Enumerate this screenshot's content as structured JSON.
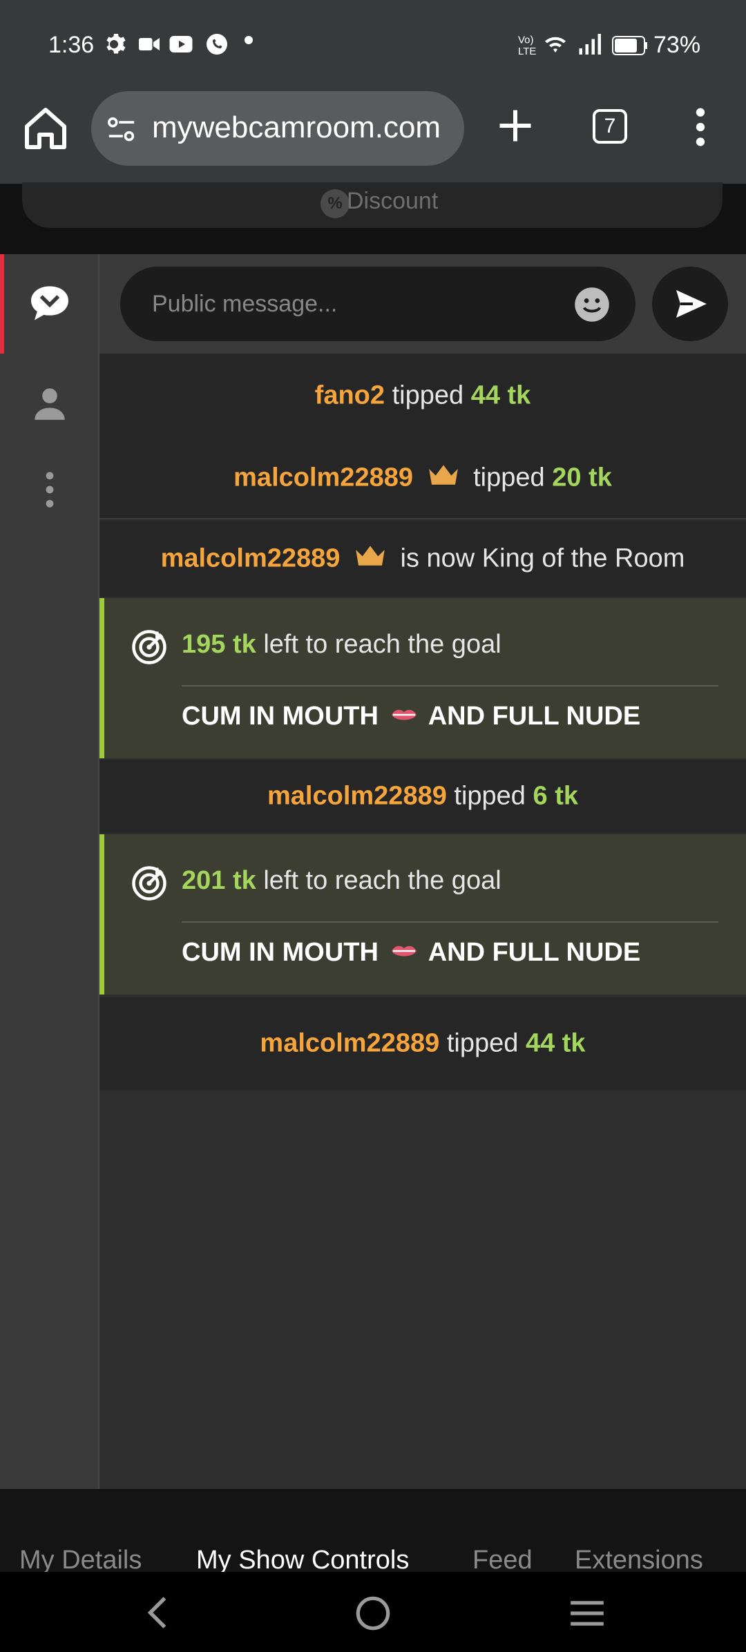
{
  "status_bar": {
    "time": "1:36",
    "battery": "73%"
  },
  "browser": {
    "url": "mywebcamroom.com",
    "tab_count": "7"
  },
  "discount": {
    "label": "Discount"
  },
  "composer": {
    "placeholder": "Public message..."
  },
  "feed": {
    "tip1": {
      "user": "fano2",
      "verb": "tipped",
      "amount": "44 tk"
    },
    "tip2": {
      "user": "malcolm22889",
      "verb": "tipped",
      "amount": "20 tk"
    },
    "king": {
      "user": "malcolm22889",
      "text": "is now King of the Room"
    },
    "goal1": {
      "amount": "195 tk",
      "text": "left to reach the goal",
      "title_a": "CUM IN MOUTH",
      "title_b": "AND FULL NUDE"
    },
    "tip3": {
      "user": "malcolm22889",
      "verb": "tipped",
      "amount": "6 tk"
    },
    "goal2": {
      "amount": "201 tk",
      "text": "left to reach the goal",
      "title_a": "CUM IN MOUTH",
      "title_b": "AND FULL NUDE"
    },
    "tip4": {
      "user": "malcolm22889",
      "verb": "tipped",
      "amount": "44 tk"
    }
  },
  "bottom_tabs": {
    "details": "My Details",
    "show_controls": "My Show Controls",
    "feed": "Feed",
    "extensions": "Extensions"
  },
  "colors": {
    "username": "#f5a53b",
    "tokens": "#a4d65e",
    "goal_bg": "#3b3e31",
    "goal_accent": "#9ccc3a",
    "active_rail": "#e0303a"
  }
}
